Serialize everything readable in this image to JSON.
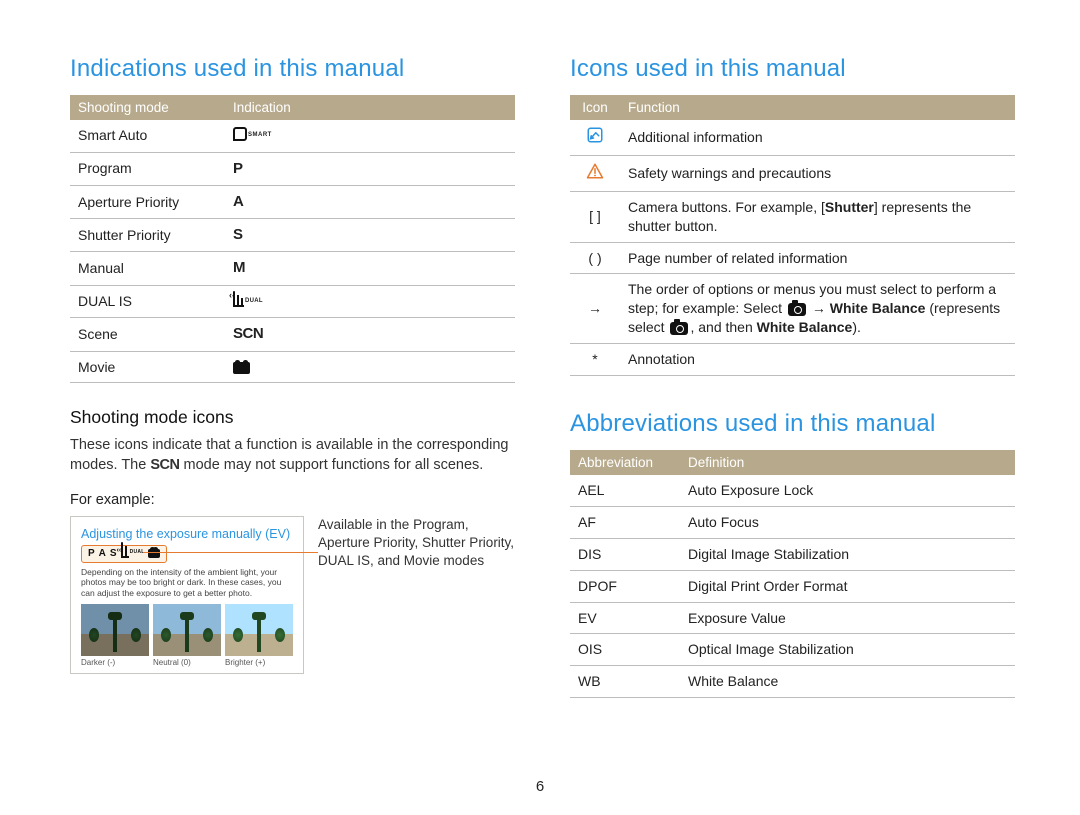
{
  "page_number": "6",
  "left": {
    "title": "Indications used in this manual",
    "table": {
      "headers": [
        "Shooting mode",
        "Indication"
      ],
      "rows": [
        {
          "mode": "Smart Auto",
          "ind_type": "smart",
          "ind_text": "SMART"
        },
        {
          "mode": "Program",
          "ind_type": "text",
          "ind_text": "P"
        },
        {
          "mode": "Aperture Priority",
          "ind_type": "text",
          "ind_text": "A"
        },
        {
          "mode": "Shutter Priority",
          "ind_type": "text",
          "ind_text": "S"
        },
        {
          "mode": "Manual",
          "ind_type": "text",
          "ind_text": "M"
        },
        {
          "mode": "DUAL IS",
          "ind_type": "dual",
          "ind_text": "DUAL"
        },
        {
          "mode": "Scene",
          "ind_type": "text",
          "ind_text": "SCN"
        },
        {
          "mode": "Movie",
          "ind_type": "movie",
          "ind_text": ""
        }
      ]
    },
    "sub_title": "Shooting mode icons",
    "body_before": "These icons indicate that a function is available in the corresponding modes. The ",
    "body_scn": "SCN",
    "body_after": " mode may not support functions for all scenes.",
    "for_label": "For example:",
    "example": {
      "title": "Adjusting the exposure manually (EV)",
      "mode_strip": [
        "P",
        "A",
        "S",
        "DUAL",
        "MOVIE"
      ],
      "hint": "Depending on the intensity of the ambient light, your photos may be too bright or dark. In these cases, you can adjust the exposure to get a better photo.",
      "thumbs": [
        "Darker (-)",
        "Neutral (0)",
        "Brighter (+)"
      ]
    },
    "example_note": "Available in the Program, Aperture Priority, Shutter Priority, DUAL IS, and Movie modes"
  },
  "right": {
    "icons_title": "Icons used in this manual",
    "icons_table": {
      "headers": [
        "Icon",
        "Function"
      ],
      "rows": [
        {
          "icon_type": "note",
          "func": "Additional information"
        },
        {
          "icon_type": "warn",
          "func": "Safety warnings and precautions"
        },
        {
          "icon_type": "brackets",
          "icon_text": "[  ]",
          "func_before": "Camera buttons. For example, [",
          "func_bold": "Shutter",
          "func_after": "] represents the shutter button."
        },
        {
          "icon_type": "parens",
          "icon_text": "(  )",
          "func": "Page number of related information"
        },
        {
          "icon_type": "arrow",
          "icon_text": "→",
          "func_l1": "The order of options or menus you must select to perform a step; for example: Select ",
          "func_arrow": " → ",
          "func_bold1": "White Balance",
          "func_mid": " (represents select ",
          "func_mid2": ", and then ",
          "func_bold2": "White Balance",
          "func_end": ")."
        },
        {
          "icon_type": "star",
          "icon_text": "*",
          "func": "Annotation"
        }
      ]
    },
    "abbr_title": "Abbreviations used in this manual",
    "abbr_table": {
      "headers": [
        "Abbreviation",
        "Definition"
      ],
      "rows": [
        {
          "abbr": "AEL",
          "def": "Auto Exposure Lock"
        },
        {
          "abbr": "AF",
          "def": "Auto Focus"
        },
        {
          "abbr": "DIS",
          "def": "Digital Image Stabilization"
        },
        {
          "abbr": "DPOF",
          "def": "Digital Print Order Format"
        },
        {
          "abbr": "EV",
          "def": "Exposure Value"
        },
        {
          "abbr": "OIS",
          "def": "Optical Image Stabilization"
        },
        {
          "abbr": "WB",
          "def": "White Balance"
        }
      ]
    }
  }
}
